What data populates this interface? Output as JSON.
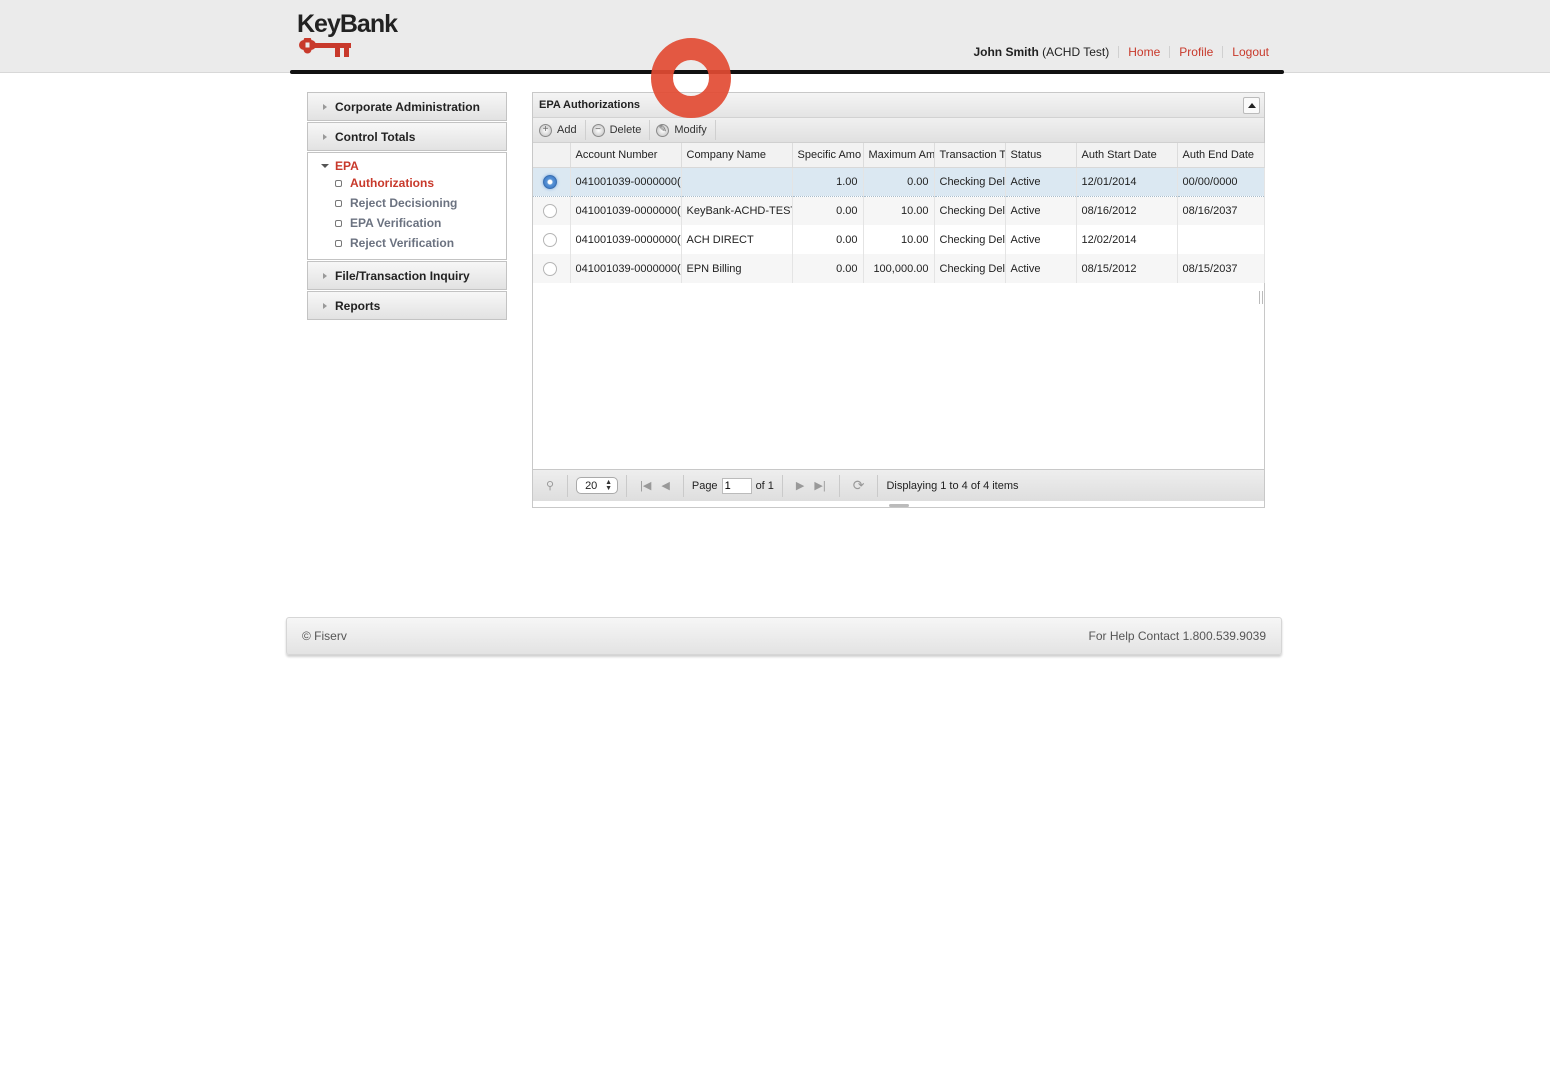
{
  "header": {
    "logo_text": "KeyBank",
    "user_name": "John Smith",
    "user_context": "(ACHD Test)",
    "links": [
      "Home",
      "Profile",
      "Logout"
    ],
    "accent_color": "#c8392b"
  },
  "sidebar": {
    "sections": [
      {
        "label": "Corporate Administration",
        "expanded": false
      },
      {
        "label": "Control Totals",
        "expanded": false
      },
      {
        "label": "EPA",
        "expanded": true,
        "items": [
          {
            "label": "Authorizations",
            "active": true
          },
          {
            "label": "Reject Decisioning",
            "active": false
          },
          {
            "label": "EPA Verification",
            "active": false
          },
          {
            "label": "Reject Verification",
            "active": false
          }
        ]
      },
      {
        "label": "File/Transaction Inquiry",
        "expanded": false
      },
      {
        "label": "Reports",
        "expanded": false
      }
    ]
  },
  "panel": {
    "title": "EPA Authorizations",
    "toolbar": {
      "add": "Add",
      "delete": "Delete",
      "modify": "Modify"
    },
    "columns": [
      "Account Number",
      "Company Name",
      "Specific Amo",
      "Maximum Am",
      "Transaction T",
      "Status",
      "Auth Start Date",
      "Auth End Date"
    ],
    "rows": [
      {
        "selected": true,
        "account": "041001039-0000000(",
        "company": "",
        "specific": "1.00",
        "maximum": "0.00",
        "type": "Checking Del",
        "status": "Active",
        "start": "12/01/2014",
        "end": "00/00/0000"
      },
      {
        "selected": false,
        "account": "041001039-0000000(",
        "company": "KeyBank-ACHD-TEST",
        "specific": "0.00",
        "maximum": "10.00",
        "type": "Checking Del",
        "status": "Active",
        "start": "08/16/2012",
        "end": "08/16/2037"
      },
      {
        "selected": false,
        "account": "041001039-0000000(",
        "company": "ACH DIRECT",
        "specific": "0.00",
        "maximum": "10.00",
        "type": "Checking Del",
        "status": "Active",
        "start": "12/02/2014",
        "end": ""
      },
      {
        "selected": false,
        "account": "041001039-0000000(",
        "company": "EPN Billing",
        "specific": "0.00",
        "maximum": "100,000.00",
        "type": "Checking Del",
        "status": "Active",
        "start": "08/15/2012",
        "end": "08/15/2037"
      }
    ],
    "pager": {
      "page_size": "20",
      "page_label": "Page",
      "page_value": "1",
      "of_label": "of 1",
      "display_text": "Displaying 1 to 4 of 4 items"
    }
  },
  "footer": {
    "copyright": "© Fiserv",
    "help": "For Help Contact 1.800.539.9039"
  }
}
